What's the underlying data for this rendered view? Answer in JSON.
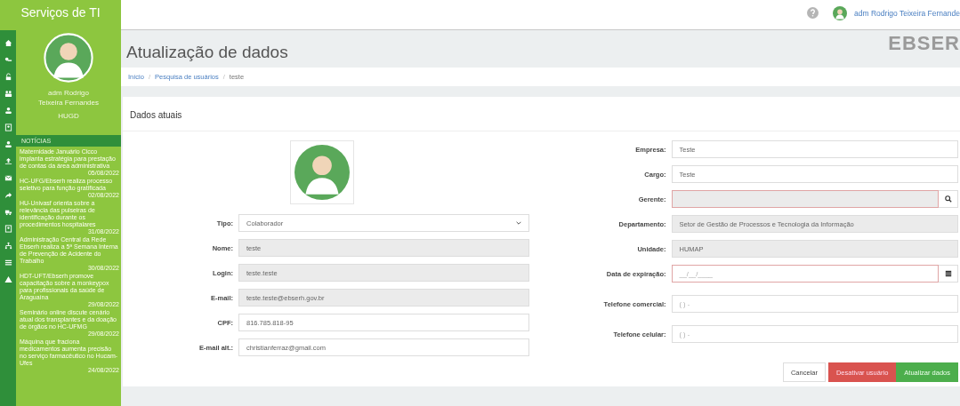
{
  "sidebar": {
    "app_title": "Serviços de TI",
    "user_name": "adm Rodrigo Teixeira Fernandes",
    "user_unit": "HUGD",
    "news_title": "NOTÍCIAS",
    "news": [
      {
        "text": "Maternidade Januário Cicco implanta estratégia para prestação de contas da área administrativa",
        "date": "05/08/2022"
      },
      {
        "text": "HC-UFG/Ebserh realiza processo seletivo para função gratificada",
        "date": "02/08/2022"
      },
      {
        "text": "HU-Univasf orienta sobre a relevância das pulseiras de identificação durante os procedimentos hospitalares",
        "date": "31/08/2022"
      },
      {
        "text": "Administração Central da Rede Ebserh realiza a 5ª Semana Interna de Prevenção de Acidente do Trabalho",
        "date": "30/08/2022"
      },
      {
        "text": "HDT-UFT/Ebserh promove capacitação sobre a monkeypox para profissionais da saúde de Araguaína",
        "date": "29/08/2022"
      },
      {
        "text": "Seminário online discute cenário atual dos transplantes e da doação de órgãos no HC-UFMG",
        "date": "29/08/2022"
      },
      {
        "text": "Máquina que fraciona medicamentos aumenta precisão no serviço farmacêutico no Hucam-Ufes",
        "date": "24/08/2022"
      }
    ]
  },
  "topbar": {
    "user_name": "adm Rodrigo Teixeira Fernande"
  },
  "page": {
    "title": "Atualização de dados",
    "logo": "EBSER",
    "breadcrumb": [
      {
        "label": "Início",
        "link": true
      },
      {
        "label": "Pesquisa de usuários",
        "link": true,
        "separator": "/"
      },
      {
        "label": "teste",
        "link": false,
        "separator": "/"
      }
    ]
  },
  "card": {
    "title": "Dados atuais",
    "left_fields": [
      {
        "label": "Tipo:",
        "kind": "select",
        "value": "Colaborador",
        "disabled": false
      },
      {
        "label": "Nome:",
        "kind": "text",
        "value": "teste",
        "disabled": true
      },
      {
        "label": "Login:",
        "kind": "text",
        "value": "teste.teste",
        "disabled": true
      },
      {
        "label": "E-mail:",
        "kind": "text",
        "value": "teste.teste@ebserh.gov.br",
        "disabled": true
      },
      {
        "label": "CPF:",
        "kind": "text",
        "value": "816.785.818-95",
        "disabled": false
      },
      {
        "label": "E-mail alt.:",
        "kind": "text",
        "value": "christianferraz@gmail.com",
        "disabled": false
      }
    ],
    "right_fields": [
      {
        "label": "Empresa:",
        "kind": "text",
        "value": "Teste",
        "disabled": false,
        "error": false
      },
      {
        "label": "Cargo:",
        "kind": "text",
        "value": "Teste",
        "disabled": false,
        "error": false
      },
      {
        "label": "Gerente:",
        "kind": "search",
        "disabled": true,
        "error": true
      },
      {
        "label": "Departamento:",
        "kind": "text",
        "value": "Setor de Gestão de Processos e Tecnologia da Informação",
        "disabled": true,
        "error": false
      },
      {
        "label": "Unidade:",
        "kind": "text",
        "value": "HUMAP",
        "disabled": true,
        "error": false
      },
      {
        "label": "Data de expiração:",
        "kind": "date",
        "placeholder": "__/__/____",
        "disabled": false,
        "error": true
      },
      {
        "label": "Telefone comercial:",
        "kind": "text",
        "placeholder": "( )    -",
        "disabled": false,
        "error": false
      },
      {
        "label": "Telefone celular:",
        "kind": "text",
        "placeholder": "( )    -",
        "disabled": false,
        "error": false
      }
    ],
    "buttons": [
      {
        "label": "Cancelar",
        "kind": "default"
      },
      {
        "label": "Desativar usuário",
        "kind": "danger"
      },
      {
        "label": "Atualizar dados",
        "kind": "success"
      }
    ]
  }
}
